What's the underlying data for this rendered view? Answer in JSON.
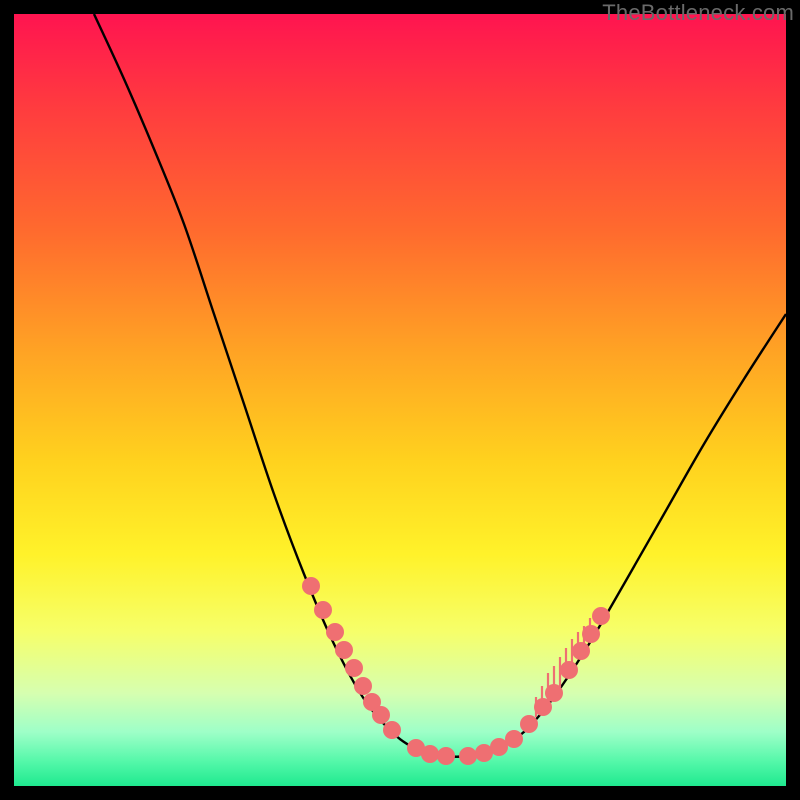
{
  "watermark": "TheBottleneck.com",
  "chart_data": {
    "type": "line",
    "title": "",
    "xlabel": "",
    "ylabel": "",
    "xlim": [
      0,
      772
    ],
    "ylim": [
      0,
      772
    ],
    "series": [
      {
        "name": "bottleneck-curve",
        "note": "No axis ticks are rendered; values are pixel-space coordinates inside the 772×772 gradient frame (y measured from top).",
        "points": [
          {
            "x": 80,
            "y": 0
          },
          {
            "x": 110,
            "y": 65
          },
          {
            "x": 140,
            "y": 135
          },
          {
            "x": 170,
            "y": 210
          },
          {
            "x": 200,
            "y": 300
          },
          {
            "x": 230,
            "y": 390
          },
          {
            "x": 260,
            "y": 480
          },
          {
            "x": 290,
            "y": 560
          },
          {
            "x": 320,
            "y": 630
          },
          {
            "x": 350,
            "y": 685
          },
          {
            "x": 380,
            "y": 720
          },
          {
            "x": 405,
            "y": 736
          },
          {
            "x": 430,
            "y": 742
          },
          {
            "x": 455,
            "y": 742
          },
          {
            "x": 480,
            "y": 736
          },
          {
            "x": 505,
            "y": 722
          },
          {
            "x": 525,
            "y": 702
          },
          {
            "x": 545,
            "y": 676
          },
          {
            "x": 575,
            "y": 630
          },
          {
            "x": 610,
            "y": 570
          },
          {
            "x": 650,
            "y": 500
          },
          {
            "x": 690,
            "y": 430
          },
          {
            "x": 730,
            "y": 365
          },
          {
            "x": 772,
            "y": 300
          }
        ]
      }
    ],
    "markers": {
      "name": "highlight-dots",
      "color": "#ef6f72",
      "radius": 9,
      "cluster_description": "Salmon dots clustered along the curve near the valley floor, plus short upward salmon tick marks on the right curve wall.",
      "points": [
        {
          "x": 297,
          "y": 572
        },
        {
          "x": 309,
          "y": 596
        },
        {
          "x": 321,
          "y": 618
        },
        {
          "x": 330,
          "y": 636
        },
        {
          "x": 340,
          "y": 654
        },
        {
          "x": 349,
          "y": 672
        },
        {
          "x": 358,
          "y": 688
        },
        {
          "x": 367,
          "y": 701
        },
        {
          "x": 378,
          "y": 716
        },
        {
          "x": 402,
          "y": 734
        },
        {
          "x": 416,
          "y": 740
        },
        {
          "x": 432,
          "y": 742
        },
        {
          "x": 454,
          "y": 742
        },
        {
          "x": 470,
          "y": 739
        },
        {
          "x": 485,
          "y": 733
        },
        {
          "x": 500,
          "y": 725
        },
        {
          "x": 515,
          "y": 710
        },
        {
          "x": 529,
          "y": 693
        },
        {
          "x": 540,
          "y": 679
        },
        {
          "x": 555,
          "y": 656
        },
        {
          "x": 567,
          "y": 637
        },
        {
          "x": 577,
          "y": 620
        },
        {
          "x": 587,
          "y": 602
        }
      ],
      "ticks": [
        {
          "x": 522,
          "y1": 703,
          "y2": 683
        },
        {
          "x": 528,
          "y1": 696,
          "y2": 672
        },
        {
          "x": 534,
          "y1": 689,
          "y2": 659
        },
        {
          "x": 540,
          "y1": 682,
          "y2": 652
        },
        {
          "x": 546,
          "y1": 673,
          "y2": 643
        },
        {
          "x": 552,
          "y1": 664,
          "y2": 634
        },
        {
          "x": 558,
          "y1": 655,
          "y2": 625
        },
        {
          "x": 564,
          "y1": 645,
          "y2": 618
        },
        {
          "x": 570,
          "y1": 635,
          "y2": 612
        },
        {
          "x": 576,
          "y1": 624,
          "y2": 604
        }
      ]
    }
  }
}
